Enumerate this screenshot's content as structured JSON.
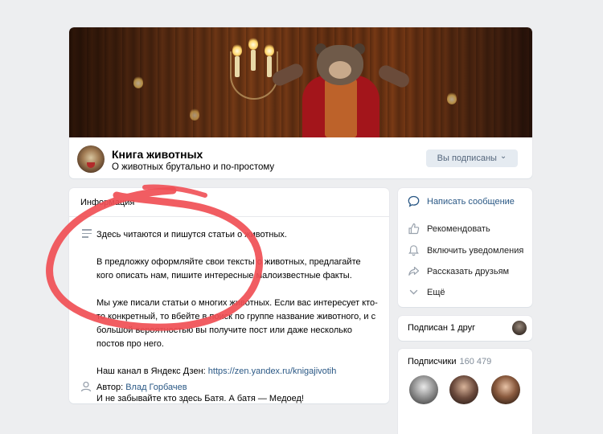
{
  "group": {
    "title": "Книга животных",
    "status": "О животных брутально и по-простому",
    "subscribed_label": "Вы подписаны",
    "subscribed_chevron": "⌄"
  },
  "info": {
    "title": "Информация",
    "description": "Здесь читаются и пишутся статьи о животных.\n\nВ предложку оформляйте свои тексты о животных, предлагайте кого описать нам, пишите интересные малоизвестные факты.\n\nМы уже писали статьи о многих животных. Если вас интересует кто-то конкретный, то вбейте в поиск по группе название животного, и с большой вероятностью вы получите пост или даже несколько постов про него.\n\n",
    "channel_prefix": "Наш канал в Яндекс Дзен: ",
    "channel_link": "https://zen.yandex.ru/knigajivotih",
    "closing": "И не забывайте кто здесь Батя. А батя — Медоед!",
    "author_label": "Автор: ",
    "author_name": "Влад Горбачев"
  },
  "actions": {
    "message": "Написать сообщение",
    "recommend": "Рекомендовать",
    "notify": "Включить уведомления",
    "share": "Рассказать друзьям",
    "more": "Ещё"
  },
  "friends": {
    "label": "Подписан 1 друг"
  },
  "subscribers": {
    "label": "Подписчики",
    "count": "160 479"
  },
  "colors": {
    "accent": "#2a5885",
    "background": "#edeef0",
    "highlight": "#f04f55"
  },
  "icons": [
    "message-icon",
    "thumbs-up-icon",
    "bell-icon",
    "share-icon",
    "chevron-down-icon",
    "description-icon",
    "person-icon"
  ]
}
